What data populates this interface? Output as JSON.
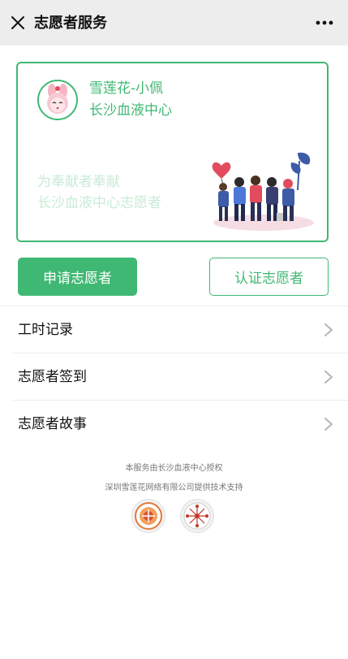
{
  "topbar": {
    "title": "志愿者服务",
    "close_icon": "close-icon",
    "more_icon": "more-dots-icon",
    "background": "#ededed"
  },
  "card": {
    "name": "雪莲花-小佩",
    "org": "长沙血液中心",
    "slogan_line1": "为奉献者奉献",
    "slogan_line2": "长沙血液中心志愿者",
    "avatar_icon": "bunny-mascot-icon",
    "illustration": "volunteers-illustration",
    "accent": "#3fb873"
  },
  "actions": {
    "apply_label": "申请志愿者",
    "certify_label": "认证志愿者"
  },
  "menu": [
    {
      "label": "工时记录"
    },
    {
      "label": "志愿者签到"
    },
    {
      "label": "志愿者故事"
    }
  ],
  "footer": {
    "line1": "本服务由长沙血液中心授权",
    "line2": "深圳雪莲花网络有限公司提供技术支持",
    "logos": [
      "blood-center-logo",
      "snowlotus-network-logo"
    ]
  }
}
